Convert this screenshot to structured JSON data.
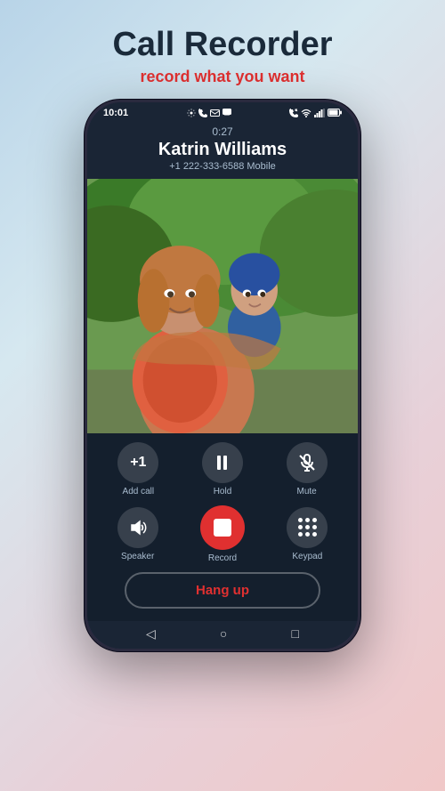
{
  "header": {
    "title": "Call Recorder",
    "subtitle": "record what you want"
  },
  "status_bar": {
    "time": "10:01",
    "left_icons": [
      "settings",
      "phone",
      "envelope",
      "message"
    ],
    "right_icons": [
      "phone-incoming",
      "wifi",
      "signal",
      "battery"
    ]
  },
  "call": {
    "duration": "0:27",
    "caller_name": "Katrin Williams",
    "caller_number": "+1 222-333-6588 Mobile"
  },
  "controls": {
    "row1": [
      {
        "id": "add-call",
        "label": "Add call",
        "icon": "+1"
      },
      {
        "id": "hold",
        "label": "Hold",
        "icon": "pause"
      },
      {
        "id": "mute",
        "label": "Mute",
        "icon": "mic-off"
      }
    ],
    "row2": [
      {
        "id": "speaker",
        "label": "Speaker",
        "icon": "speaker"
      },
      {
        "id": "record",
        "label": "Record",
        "icon": "record"
      },
      {
        "id": "keypad",
        "label": "Keypad",
        "icon": "keypad"
      }
    ],
    "hangup": "Hang up"
  },
  "nav": {
    "back": "◁",
    "home": "○",
    "recent": "□"
  },
  "colors": {
    "background_gradient_start": "#b8d4e8",
    "background_gradient_end": "#f0c8c8",
    "title_color": "#1a2a3a",
    "subtitle_color": "#e03030",
    "record_button_color": "#e03030",
    "hangup_color": "#e03030",
    "phone_bg": "#1a2535",
    "control_label": "#aabdd0"
  }
}
